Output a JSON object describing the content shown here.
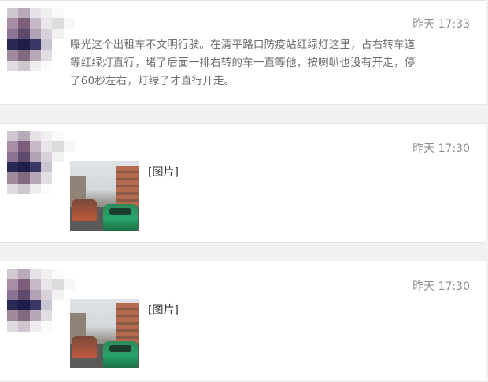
{
  "avatar_palette": [
    "#cfc8d0",
    "#b9aab9",
    "#e6e1e6",
    "#f0eef0",
    "#fafafa",
    "#ffffff",
    "#a88ea5",
    "#7d5e7a",
    "#c9b8c7",
    "#e9e6ea",
    "#dcdcdc",
    "#f7f7f7",
    "#8b7394",
    "#5d4a6d",
    "#b3a2b5",
    "#d8d1da",
    "#f2f2f2",
    "#ffffff",
    "#2a2855",
    "#1f1e4a",
    "#3a3665",
    "#c9c6d2",
    "#ffffff",
    "#ffffff",
    "#9f8a9c",
    "#7f6a80",
    "#b8a8b6",
    "#e2dde2",
    "#ffffff",
    "#ffffff",
    "#e0dbe0",
    "#cfc6cf",
    "#efecef",
    "#fbfbfb",
    "#ffffff",
    "#ffffff"
  ],
  "posts": [
    {
      "time": "昨天 17:33",
      "text": "曝光这个出租车不文明行驶。在清平路口防疫站红绿灯这里，占右转车道等红绿灯直行，堵了后面一排右转的车一直等他，按喇叭也没有开走，停了60秒左右，灯绿了才直行开走。"
    },
    {
      "time": "昨天 17:30",
      "image_label": "[图片]"
    },
    {
      "time": "昨天 17:30",
      "image_label": "[图片]"
    }
  ]
}
